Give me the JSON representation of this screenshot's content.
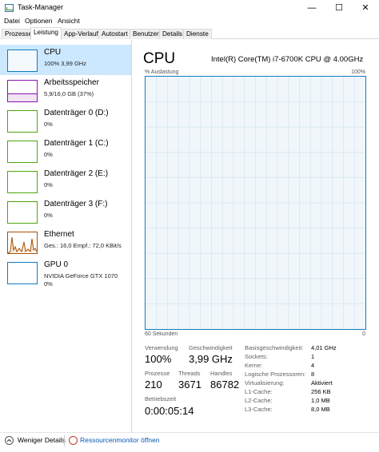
{
  "window": {
    "title": "Task-Manager",
    "minimize_glyph": "—",
    "maximize_glyph": "☐",
    "close_glyph": "✕"
  },
  "menu": [
    "Datei",
    "Optionen",
    "Ansicht"
  ],
  "tabs": [
    "Prozesse",
    "Leistung",
    "App-Verlauf",
    "Autostart",
    "Benutzer",
    "Details",
    "Dienste"
  ],
  "active_tab": "Leistung",
  "sidebar": [
    {
      "name": "CPU",
      "detail": "100% 3,99 GHz",
      "color": "#117dbb",
      "icon": "cpu-graph-icon"
    },
    {
      "name": "Arbeitsspeicher",
      "detail": "5,9/16,0 GB (37%)",
      "color": "#8b12ae",
      "icon": "memory-graph-icon"
    },
    {
      "name": "Datenträger 0 (D:)",
      "detail": "0%",
      "color": "#4da60c",
      "icon": "disk-graph-icon"
    },
    {
      "name": "Datenträger 1 (C:)",
      "detail": "0%",
      "color": "#4da60c",
      "icon": "disk-graph-icon"
    },
    {
      "name": "Datenträger 2 (E:)",
      "detail": "0%",
      "color": "#4da60c",
      "icon": "disk-graph-icon"
    },
    {
      "name": "Datenträger 3 (F:)",
      "detail": "0%",
      "color": "#4da60c",
      "icon": "disk-graph-icon"
    },
    {
      "name": "Ethernet",
      "detail": "Ges.: 16,0  Empf.: 72,0 KBit/s",
      "color": "#a74f01",
      "icon": "network-graph-icon"
    },
    {
      "name": "GPU 0",
      "detail": "NVIDIA GeForce GTX 1070",
      "detail2": "0%",
      "color": "#117dbb",
      "icon": "gpu-graph-icon"
    }
  ],
  "main": {
    "title": "CPU",
    "model": "Intel(R) Core(TM) i7-6700K CPU @ 4.00GHz",
    "graph_label_left": "% Auslastung",
    "graph_label_right": "100%",
    "graph_bottom_left": "60 Sekunden",
    "graph_bottom_right": "0",
    "graph_color": "#117dbb",
    "stats": {
      "verwendung_label": "Verwendung",
      "verwendung_value": "100%",
      "geschw_label": "Geschwindigkeit",
      "geschw_value": "3,99 GHz",
      "prozesse_label": "Prozesse",
      "prozesse_value": "210",
      "threads_label": "Threads",
      "threads_value": "3671",
      "handles_label": "Handles",
      "handles_value": "86782",
      "betrieb_label": "Betriebszeit",
      "betrieb_value": "0:00:05:14"
    },
    "details": [
      {
        "label": "Basisgeschwindigkeit:",
        "value": "4,01 GHz"
      },
      {
        "label": "Sockets:",
        "value": "1"
      },
      {
        "label": "Kerne:",
        "value": "4"
      },
      {
        "label": "Logische Prozessoren:",
        "value": "8"
      },
      {
        "label": "Virtualisierung:",
        "value": "Aktiviert"
      },
      {
        "label": "L1-Cache:",
        "value": "256 KB"
      },
      {
        "label": "L2-Cache:",
        "value": "1,0 MB"
      },
      {
        "label": "L3-Cache:",
        "value": "8,0 MB"
      }
    ]
  },
  "footer": {
    "fewer_details": "Weniger Details",
    "resource_monitor": "Ressourcenmonitor öffnen"
  }
}
